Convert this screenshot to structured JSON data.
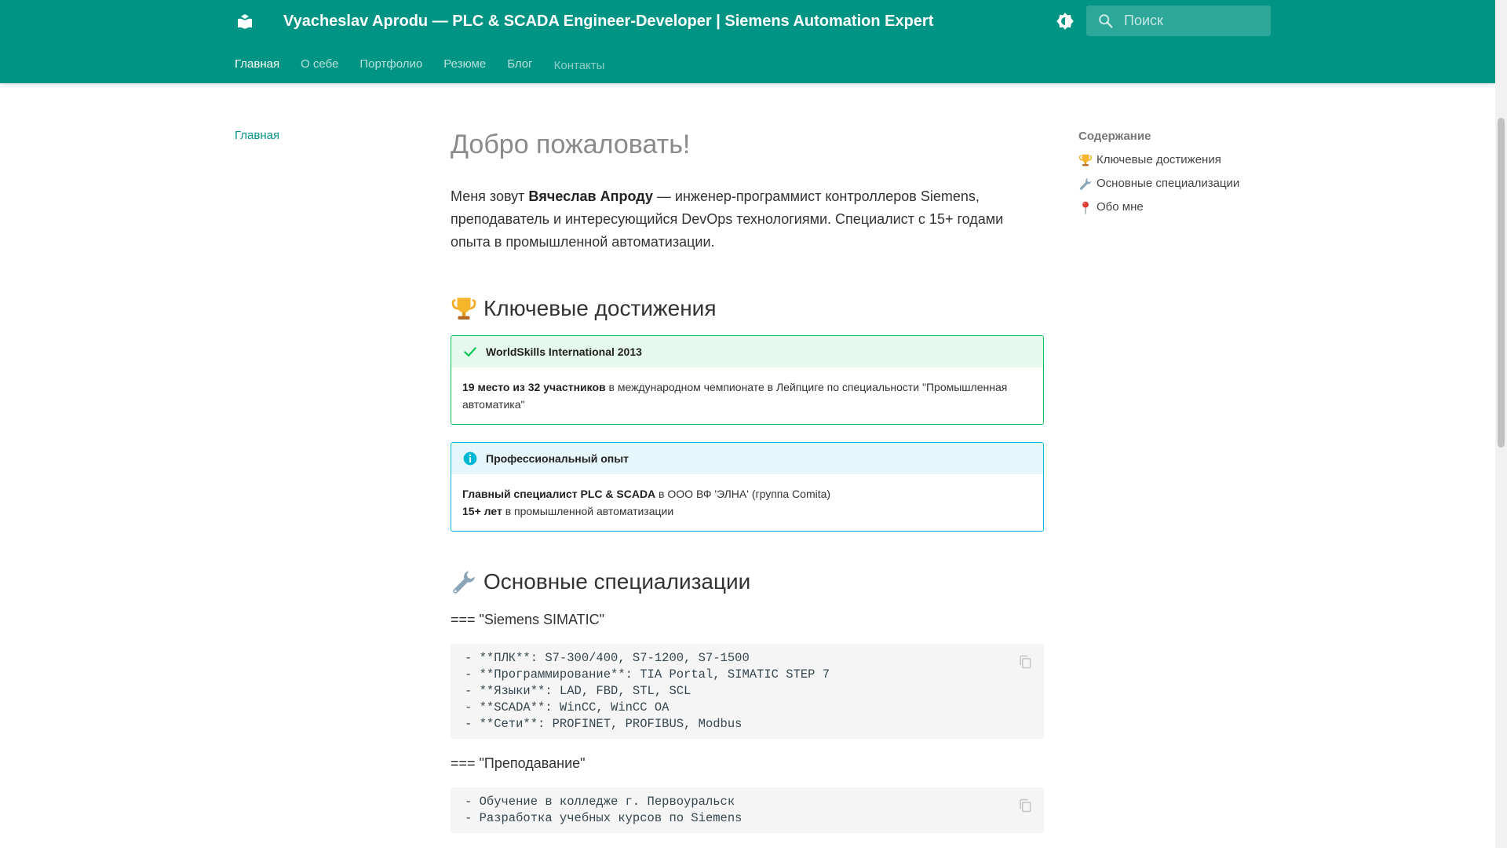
{
  "header": {
    "title": "Vyacheslav Aprodu — PLC & SCADA Engineer-Developer | Siemens Automation Expert",
    "search_placeholder": "Поиск",
    "accent_color": "#009485",
    "logo_icon": "book-icon",
    "theme_icon": "brightness-icon"
  },
  "tabs": [
    {
      "label": "Главная"
    },
    {
      "label": "О себе"
    },
    {
      "label": "Портфолио"
    },
    {
      "label": "Резюме"
    },
    {
      "label": "Блог"
    },
    {
      "label": "Контакты"
    }
  ],
  "leftnav": {
    "item": "Главная"
  },
  "content": {
    "title": "Добро пожаловать!",
    "intro": {
      "prefix": "Меня зовут ",
      "name": "Вячеслав Апроду",
      "suffix": " — инженер-программист контроллеров Siemens, преподаватель и интересующийся DevOps технологиями. Специалист с 15+ годами опыта в промышленной автоматизации."
    },
    "section1": {
      "emoji": "trophy",
      "title": "Ключевые достижения"
    },
    "admon_success": {
      "title": "WorldSkills International 2013",
      "bold": "19 место из 32 участников",
      "text": " в международном чемпионате в Лейпциге по специальности \"Промышленная автоматика\""
    },
    "admon_info": {
      "title": "Профессиональный опыт",
      "line1_bold": "Главный специалист PLC & SCADA",
      "line1_text": " в ООО ВФ 'ЭЛНА' (группа Comita)",
      "line2_bold": "15+ лет",
      "line2_text": " в промышленной автоматизации"
    },
    "section2": {
      "emoji": "wrench",
      "title": "Основные специализации"
    },
    "tab_siemens": "=== \"Siemens SIMATIC\"",
    "code1": [
      "- **ПЛК**: S7-300/400, S7-1200, S7-1500",
      "- **Программирование**: TIA Portal, SIMATIC STEP 7",
      "- **Языки**: LAD, FBD, STL, SCL",
      "- **SCADA**: WinCC, WinCC OA",
      "- **Сети**: PROFINET, PROFIBUS, Modbus"
    ],
    "tab_teaching": "=== \"Преподавание\"",
    "code2": [
      "- Обучение в колледже г. Первоуральск",
      "- Разработка учебных курсов по Siemens"
    ]
  },
  "toc": {
    "title": "Содержание",
    "items": [
      {
        "emoji": "trophy",
        "label": "Ключевые достижения"
      },
      {
        "emoji": "wrench",
        "label": "Основные специализации"
      },
      {
        "emoji": "pin",
        "label": "Обо мне"
      }
    ]
  }
}
